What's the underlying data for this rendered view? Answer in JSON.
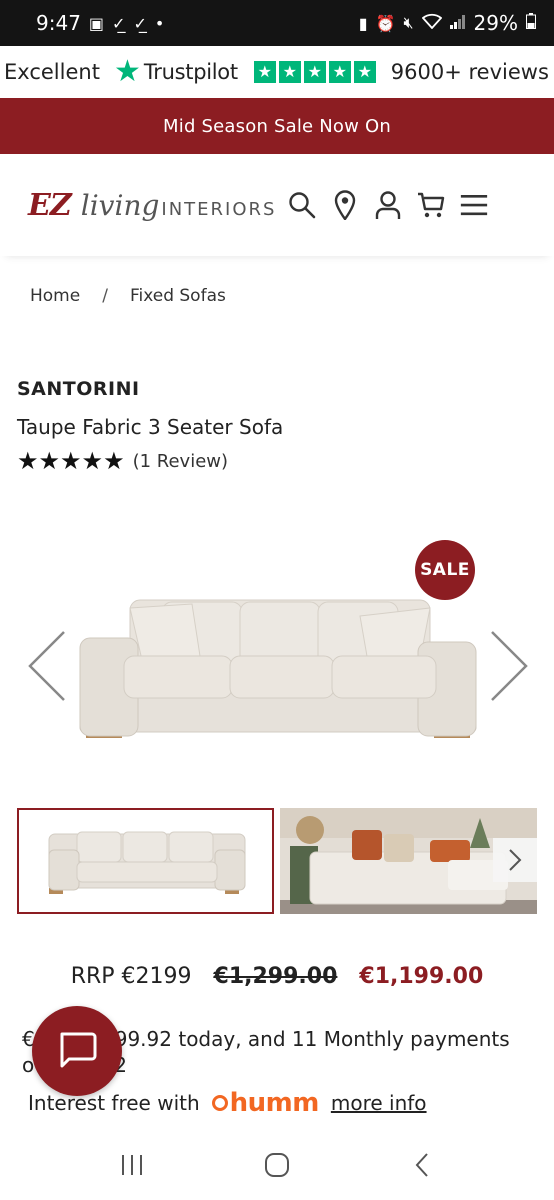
{
  "status_bar": {
    "time": "9:47",
    "battery": "29%"
  },
  "trustpilot": {
    "rating_word": "Excellent",
    "brand": "Trustpilot",
    "reviews": "9600+ reviews",
    "star_color": "#00b67a"
  },
  "promo": {
    "text": "Mid Season Sale Now On",
    "bg_color": "#8c1d22"
  },
  "header": {
    "logo_ez": "EZ",
    "logo_living": "living",
    "logo_interiors": "INTERIORS",
    "icons": [
      "search-icon",
      "location-icon",
      "account-icon",
      "cart-icon",
      "menu-icon"
    ]
  },
  "breadcrumb": {
    "home": "Home",
    "separator": "/",
    "current": "Fixed Sofas"
  },
  "product": {
    "brand": "SANTORINI",
    "title": "Taupe Fabric 3 Seater Sofa",
    "stars": "★★★★★",
    "rating_value": 5,
    "review_count": "(1 Review)",
    "sale_badge": "SALE"
  },
  "gallery": {
    "thumbnail_count_visible": 2,
    "selected_index": 0
  },
  "price": {
    "rrp": "RRP €2199",
    "was": "€1,299.00",
    "now": "€1,199.00"
  },
  "payment": {
    "line1": "99.92 today, and 11 Monthly payments",
    "line1_prefix": "€",
    "line2": "2",
    "line2_prefix": "o",
    "interest_free": "Interest free with",
    "provider": "humm",
    "more_info": "more info"
  },
  "colors": {
    "brand_red": "#8c1d22",
    "trustpilot_green": "#00b67a",
    "humm_orange": "#f26722"
  }
}
